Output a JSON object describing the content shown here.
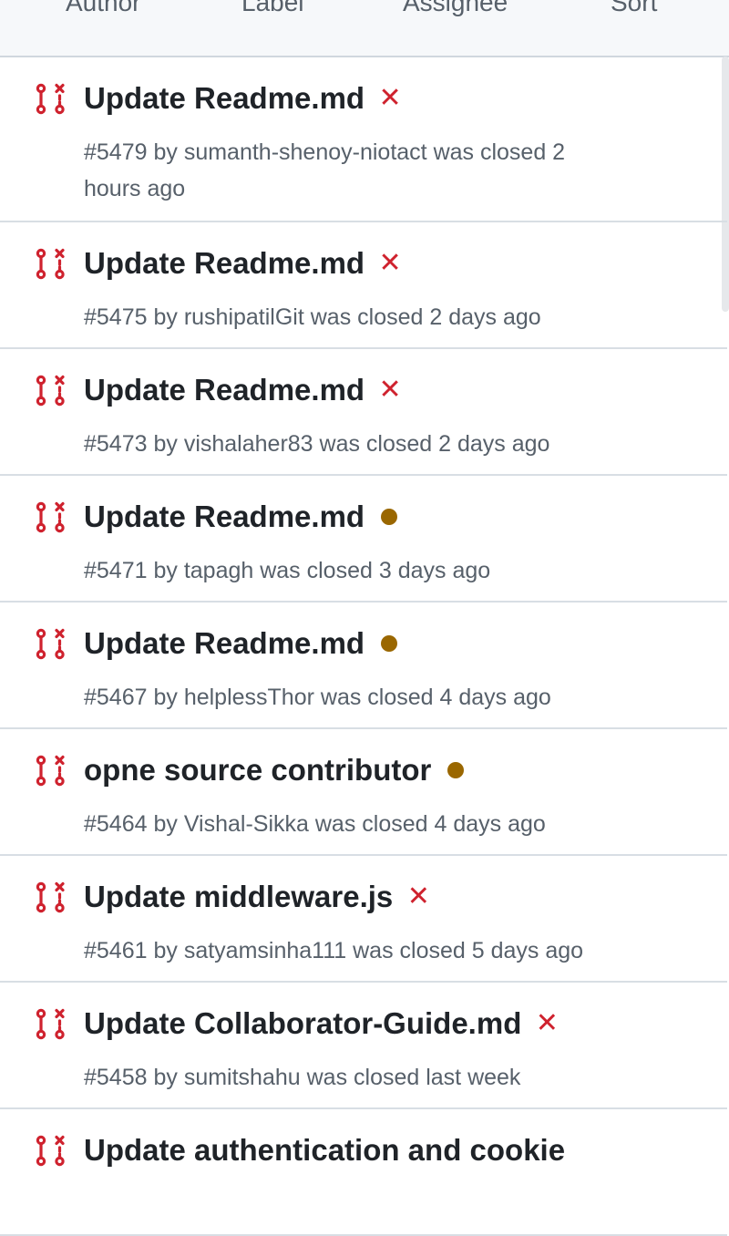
{
  "filters": [
    {
      "label": "Author"
    },
    {
      "label": "Label"
    },
    {
      "label": "Assignee"
    },
    {
      "label": "Sort"
    }
  ],
  "colors": {
    "closed_pr": "#cf222e",
    "check_failed": "#cf222e",
    "check_pending": "#9a6700"
  },
  "pulls": [
    {
      "title": "Update Readme.md",
      "status": "failed",
      "status_glyph": "✕",
      "meta": "#5479 by sumanth-shenoy-niotact was closed 2 hours ago"
    },
    {
      "title": "Update Readme.md",
      "status": "failed",
      "status_glyph": "✕",
      "meta": "#5475 by rushipatilGit was closed 2 days ago"
    },
    {
      "title": "Update Readme.md",
      "status": "failed",
      "status_glyph": "✕",
      "meta": "#5473 by vishalaher83 was closed 2 days ago"
    },
    {
      "title": "Update Readme.md",
      "status": "pending",
      "status_glyph": "",
      "meta": "#5471 by tapagh was closed 3 days ago"
    },
    {
      "title": "Update Readme.md",
      "status": "pending",
      "status_glyph": "",
      "meta": "#5467 by helplessThor was closed 4 days ago"
    },
    {
      "title": "opne source contributor",
      "status": "pending",
      "status_glyph": "",
      "meta": "#5464 by Vishal-Sikka was closed 4 days ago"
    },
    {
      "title": "Update middleware.js",
      "status": "failed",
      "status_glyph": "✕",
      "meta": "#5461 by satyamsinha111 was closed 5 days ago"
    },
    {
      "title": "Update Collaborator-Guide.md",
      "status": "failed",
      "status_glyph": "✕",
      "meta": "#5458 by sumitshahu was closed last week"
    },
    {
      "title": "Update authentication and cookie",
      "status": "",
      "status_glyph": "",
      "meta": ""
    }
  ]
}
